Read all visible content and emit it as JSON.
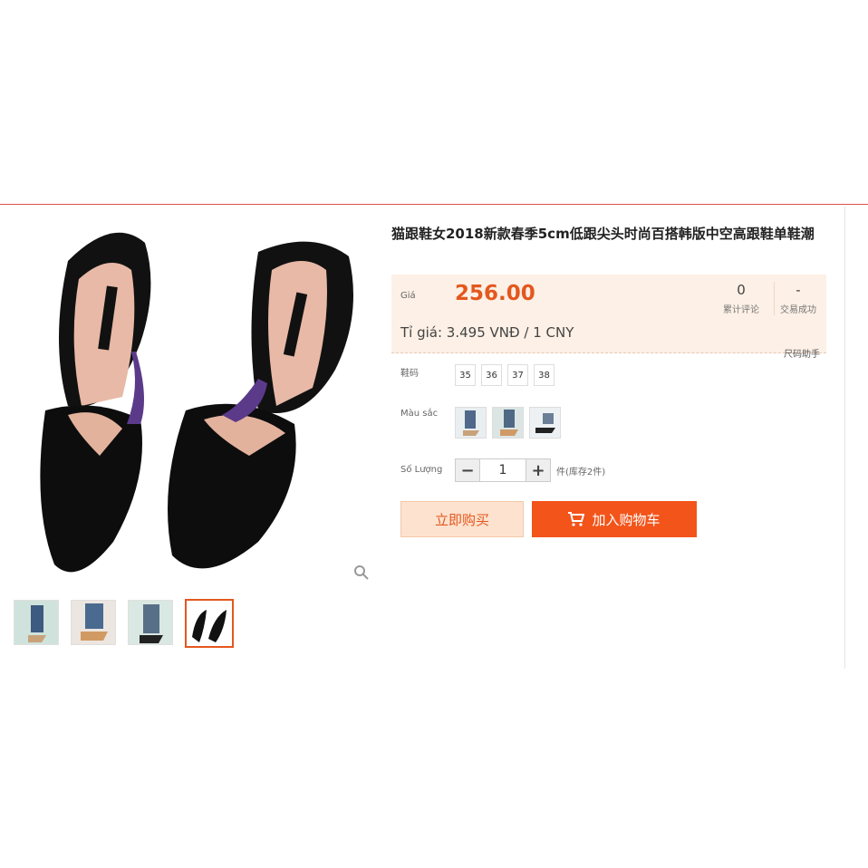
{
  "product": {
    "title": "猫跟鞋女2018新款春季5cm低跟尖头时尚百搭韩版中空高跟鞋单鞋潮"
  },
  "price": {
    "label": "Giá",
    "value": "256.00",
    "rate": "Tỉ giá: 3.495 VNĐ / 1 CNY"
  },
  "stats": {
    "reviews": {
      "value": "0",
      "label": "累计评论"
    },
    "trades": {
      "value": "-",
      "label": "交易成功"
    }
  },
  "size_helper": "尺码助手",
  "options": {
    "size_label": "鞋码",
    "sizes": [
      "35",
      "36",
      "37",
      "38"
    ],
    "color_label": "Màu sắc",
    "quantity_label": "Số Lượng",
    "quantity_value": "1",
    "stock_text": "件(库存2件)"
  },
  "actions": {
    "buy_now": "立即购买",
    "add_to_cart": "加入购物车"
  },
  "colors": {
    "accent": "#e4571e",
    "price_bg": "#fdf0e6",
    "cart_button": "#f3541a"
  },
  "icons": {
    "zoom": "magnifier-icon",
    "cart": "cart-icon"
  }
}
